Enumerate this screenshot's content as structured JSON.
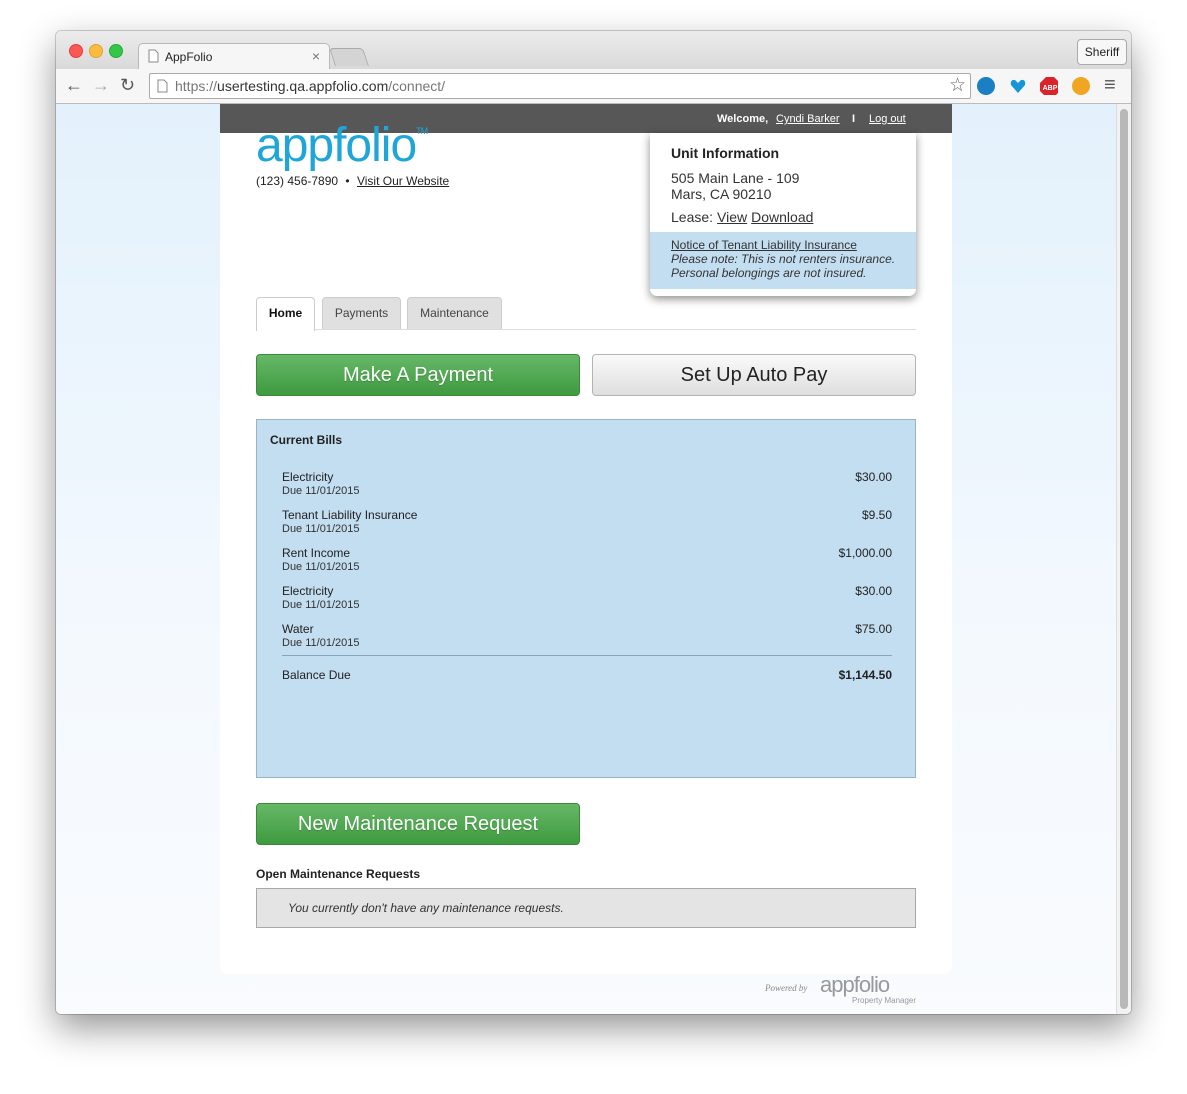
{
  "browser": {
    "tab_title": "AppFolio",
    "tab_close": "×",
    "profile": "Sheriff",
    "url_scheme": "https://",
    "url_host": "usertesting.qa.appfolio.com",
    "url_path": "/connect/",
    "back_icon": "←",
    "forward_icon": "→",
    "reload_icon": "↻",
    "star_icon": "☆",
    "menu_icon": "≡",
    "abp_label": "ABP",
    "traffic_lights": [
      "#fc5753",
      "#fdbc40",
      "#33c748"
    ],
    "extension_colors": [
      "#1b7fc4",
      "#1496d9",
      "#d9252a",
      "#f0a623"
    ]
  },
  "header": {
    "welcome": "Welcome,",
    "user_name": "Cyndi Barker",
    "separator": "I",
    "logout": "Log out"
  },
  "brand": {
    "logo_text": "appfolio",
    "tm": "TM",
    "phone": "(123) 456-7890",
    "bullet": "•",
    "website_link": "Visit Our Website",
    "logo_color": "#1fa6d8"
  },
  "unit": {
    "heading": "Unit Information",
    "address_line1": "505 Main Lane - 109",
    "address_line2": "Mars, CA 90210",
    "lease_label": "Lease:",
    "lease_view": "View",
    "lease_download": "Download",
    "notice_title": "Notice of Tenant Liability Insurance",
    "notice_line1": "Please note: This is not renters insurance.",
    "notice_line2": "Personal belongings are not insured."
  },
  "tabs": [
    "Home",
    "Payments",
    "Maintenance"
  ],
  "actions": {
    "make_payment": "Make A Payment",
    "auto_pay": "Set Up Auto Pay",
    "new_request": "New Maintenance Request"
  },
  "bills": {
    "heading": "Current Bills",
    "items": [
      {
        "name": "Electricity",
        "due": "Due 11/01/2015",
        "amount": "$30.00"
      },
      {
        "name": "Tenant Liability Insurance",
        "due": "Due 11/01/2015",
        "amount": "$9.50"
      },
      {
        "name": "Rent Income",
        "due": "Due 11/01/2015",
        "amount": "$1,000.00"
      },
      {
        "name": "Electricity",
        "due": "Due 11/01/2015",
        "amount": "$30.00"
      },
      {
        "name": "Water",
        "due": "Due 11/01/2015",
        "amount": "$75.00"
      }
    ],
    "balance_label": "Balance Due",
    "balance_amount": "$1,144.50"
  },
  "maintenance": {
    "heading": "Open Maintenance Requests",
    "empty_message": "You currently don't have any maintenance requests."
  },
  "footer": {
    "powered_by": "Powered by",
    "logo_text": "appfolio",
    "sub": "Property Manager"
  }
}
